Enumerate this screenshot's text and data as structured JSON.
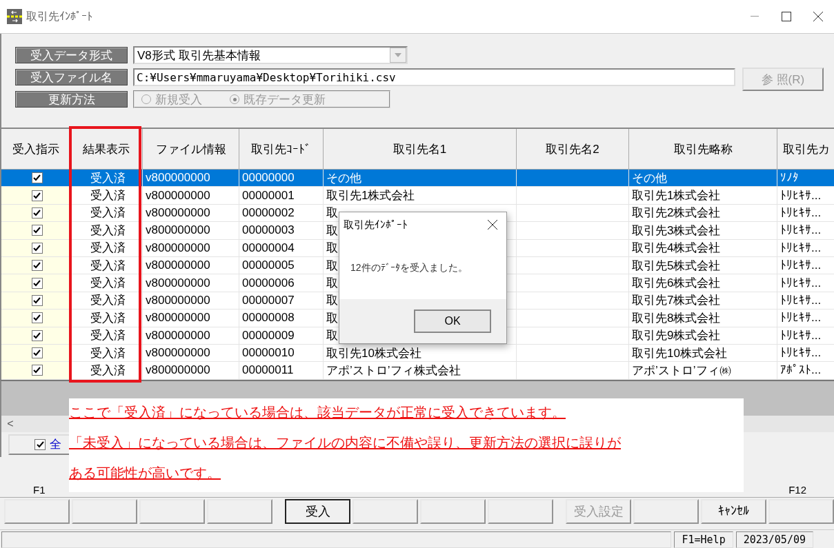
{
  "window": {
    "title": "取引先ｲﾝﾎﾟｰﾄ"
  },
  "form": {
    "format": {
      "label": "受入データ形式",
      "value": "V8形式 取引先基本情報"
    },
    "file": {
      "label": "受入ファイル名",
      "value": "C:¥Users¥mmaruyama¥Desktop¥Torihiki.csv"
    },
    "browse_button": {
      "label": "参 照(R)",
      "disabled": true
    },
    "method": {
      "label": "更新方法",
      "disabled": true,
      "options": [
        {
          "label": "新規受入",
          "selected": false
        },
        {
          "label": "既存データ更新",
          "selected": true
        }
      ]
    }
  },
  "table": {
    "columns": [
      "受入指示",
      "結果表示",
      "ファイル情報",
      "取引先ｺｰﾄﾞ",
      "取引先名1",
      "取引先名2",
      "取引先略称",
      "取引先カ"
    ],
    "rows": [
      {
        "selected": true,
        "checked": true,
        "result": "受入済",
        "file": "v800000000",
        "code": "00000000",
        "name1": "その他",
        "abbr": "その他",
        "kana": "ｿﾉﾀ"
      },
      {
        "selected": false,
        "checked": true,
        "result": "受入済",
        "file": "v800000000",
        "code": "00000001",
        "name1": "取引先1株式会社",
        "abbr": "取引先1株式会社",
        "kana": "ﾄﾘﾋｷｻ..."
      },
      {
        "selected": false,
        "checked": true,
        "result": "受入済",
        "file": "v800000000",
        "code": "00000002",
        "name1": "取",
        "abbr": "取引先2株式会社",
        "kana": "ﾄﾘﾋｷｻ..."
      },
      {
        "selected": false,
        "checked": true,
        "result": "受入済",
        "file": "v800000000",
        "code": "00000003",
        "name1": "取",
        "abbr": "取引先3株式会社",
        "kana": "ﾄﾘﾋｷｻ..."
      },
      {
        "selected": false,
        "checked": true,
        "result": "受入済",
        "file": "v800000000",
        "code": "00000004",
        "name1": "取",
        "abbr": "取引先4株式会社",
        "kana": "ﾄﾘﾋｷｻ..."
      },
      {
        "selected": false,
        "checked": true,
        "result": "受入済",
        "file": "v800000000",
        "code": "00000005",
        "name1": "取",
        "abbr": "取引先5株式会社",
        "kana": "ﾄﾘﾋｷｻ..."
      },
      {
        "selected": false,
        "checked": true,
        "result": "受入済",
        "file": "v800000000",
        "code": "00000006",
        "name1": "取",
        "abbr": "取引先6株式会社",
        "kana": "ﾄﾘﾋｷｻ..."
      },
      {
        "selected": false,
        "checked": true,
        "result": "受入済",
        "file": "v800000000",
        "code": "00000007",
        "name1": "取",
        "abbr": "取引先7株式会社",
        "kana": "ﾄﾘﾋｷｻ..."
      },
      {
        "selected": false,
        "checked": true,
        "result": "受入済",
        "file": "v800000000",
        "code": "00000008",
        "name1": "取",
        "abbr": "取引先8株式会社",
        "kana": "ﾄﾘﾋｷｻ..."
      },
      {
        "selected": false,
        "checked": true,
        "result": "受入済",
        "file": "v800000000",
        "code": "00000009",
        "name1": "取",
        "abbr": "取引先9株式会社",
        "kana": "ﾄﾘﾋｷｻ..."
      },
      {
        "selected": false,
        "checked": true,
        "result": "受入済",
        "file": "v800000000",
        "code": "00000010",
        "name1": "取引先10株式会社",
        "abbr": "取引先10株式会社",
        "kana": "ﾄﾘﾋｷｻ..."
      },
      {
        "selected": false,
        "checked": true,
        "result": "受入済",
        "file": "v800000000",
        "code": "00000011",
        "name1": "アポ’ストロ’フィ株式会社",
        "abbr": "アポ’ストロ’フィ㈱",
        "kana": "ｱﾎﾟｽﾄ..."
      }
    ]
  },
  "scrollbar": {
    "left_arrow": "<"
  },
  "select_all": {
    "label": "全",
    "checked": true
  },
  "function_key_labels": {
    "first": "F1",
    "last": "F12"
  },
  "buttons": [
    {
      "kind": "empty"
    },
    {
      "kind": "empty"
    },
    {
      "kind": "empty"
    },
    {
      "kind": "empty"
    },
    {
      "kind": "action",
      "label": "受入",
      "default": true,
      "disabled": false
    },
    {
      "kind": "empty"
    },
    {
      "kind": "empty"
    },
    {
      "kind": "empty"
    },
    {
      "kind": "action",
      "label": "受入設定",
      "default": false,
      "disabled": true
    },
    {
      "kind": "empty"
    },
    {
      "kind": "action",
      "label": "ｷｬﾝｾﾙ",
      "default": false,
      "disabled": false
    },
    {
      "kind": "empty"
    }
  ],
  "status_bar": {
    "help": "F1=Help",
    "date": "2023/05/09"
  },
  "dialog": {
    "title": "取引先ｲﾝﾎﾟｰﾄ",
    "message": "12件のﾃﾞｰﾀを受入ました。",
    "ok": "OK"
  },
  "annotation": {
    "lines": [
      "ここで「受入済」になっている場合は、該当データが正常に受入できています。",
      "「未受入」になっている場合は、ファイルの内容に不備や誤り、更新方法の選択に誤りが",
      "ある可能性が高いです。"
    ]
  }
}
